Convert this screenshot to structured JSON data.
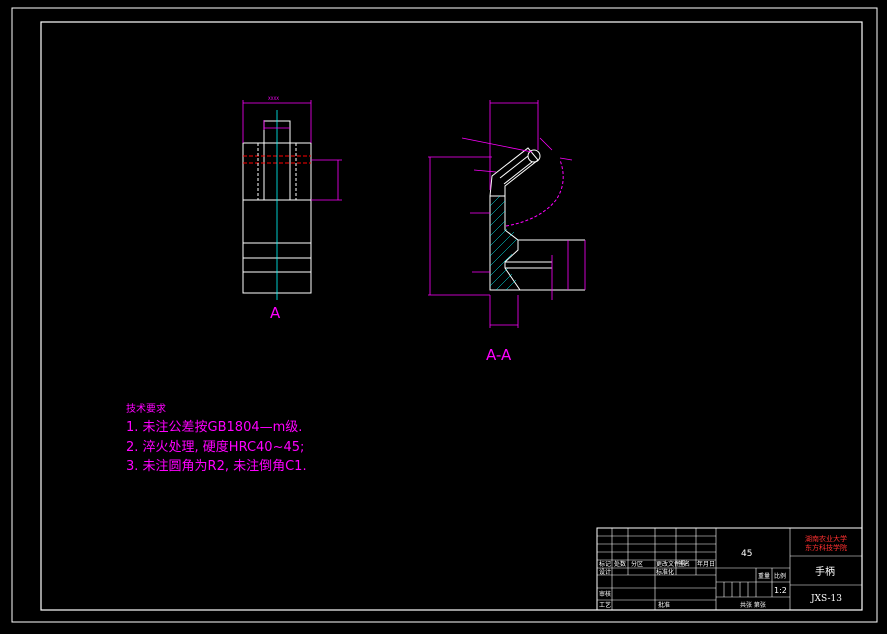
{
  "drawing": {
    "view_a_label": "A",
    "view_aa_label": "A-A",
    "dim_top_width": "XXXX",
    "tech_requirements": {
      "heading": "技术要求",
      "items": [
        "1. 未注公差按GB1804—m级.",
        "2. 淬火处理, 硬度HRC40~45;",
        "3. 未注圆角为R2, 未注倒角C1."
      ]
    }
  },
  "title_block": {
    "school_line1": "湖南农业大学",
    "school_line2": "东方科技学院",
    "material": "45",
    "part_name": "手柄",
    "drawing_number": "JXS-13",
    "scale_label": "比例",
    "scale_value": "1:2",
    "weight_label": "重量",
    "rows": {
      "mark": "标记",
      "count": "处数",
      "zone": "分区",
      "change_doc": "更改文件号",
      "signature": "签名",
      "date": "年月日",
      "designer": "设计",
      "standardize": "标准化",
      "check": "审核",
      "process": "工艺",
      "approve": "批准",
      "sheets": "共张 第张"
    }
  },
  "colors": {
    "background": "#000000",
    "frame": "#ffffff",
    "dimension": "#ff00ff",
    "text": "#ff00ff",
    "centerline": "#00ffff",
    "hatch": "#00ffff",
    "cut_line": "#ff0000",
    "school_text": "#ff3030"
  }
}
